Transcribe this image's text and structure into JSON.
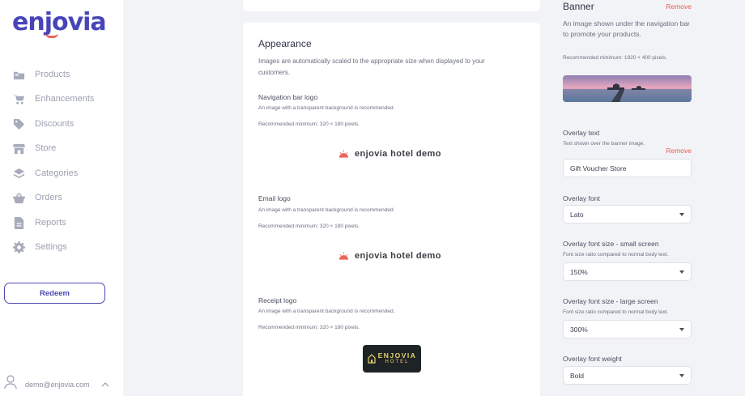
{
  "brand": {
    "name": "enjovia",
    "accent": "#4745b8",
    "dot_color": "#e9665b"
  },
  "sidebar": {
    "items": [
      {
        "label": "Products",
        "icon": "products-icon"
      },
      {
        "label": "Enhancements",
        "icon": "cart-icon"
      },
      {
        "label": "Discounts",
        "icon": "tag-icon"
      },
      {
        "label": "Store",
        "icon": "store-icon"
      },
      {
        "label": "Categories",
        "icon": "layers-icon"
      },
      {
        "label": "Orders",
        "icon": "basket-icon"
      },
      {
        "label": "Reports",
        "icon": "file-icon"
      },
      {
        "label": "Settings",
        "icon": "gear-icon"
      }
    ],
    "redeem_label": "Redeem",
    "user_email": "demo@enjovia.com",
    "user_chevron": "^"
  },
  "appearance": {
    "title": "Appearance",
    "intro": "Images are automatically scaled to the appropriate size when displayed to your customers.",
    "nav_logo": {
      "title": "Navigation bar logo",
      "desc": "An image with a transparent background is recommended.",
      "rec": "Recommended minimum: 320 × 180 pixels.",
      "logo_text": "enjovia hotel demo"
    },
    "email_logo": {
      "title": "Email logo",
      "desc": "An image with a transparent background is recommended.",
      "rec": "Recommended minimum: 320 × 180 pixels.",
      "logo_text": "enjovia hotel demo"
    },
    "receipt_logo": {
      "title": "Receipt logo",
      "desc": "An image with a transparent background is recommended.",
      "rec": "Recommended minimum: 320 × 180 pixels.",
      "logo_text": "ENJOVIA",
      "logo_sub": "HOTEL"
    }
  },
  "banner": {
    "title": "Banner",
    "remove_label": "Remove",
    "desc": "An image shown under the navigation bar to promote your products.",
    "rec": "Recommended minimum: 1920 × 400 pixels.",
    "overlay_text": {
      "label": "Overlay text",
      "help": "Text shown over the banner image.",
      "remove_label": "Remove",
      "value": "Gift Voucher Store"
    },
    "overlay_font": {
      "label": "Overlay font",
      "value": "Lato"
    },
    "font_small": {
      "label": "Overlay font size - small screen",
      "help": "Font size ratio compared to normal body text.",
      "value": "150%"
    },
    "font_large": {
      "label": "Overlay font size - large screen",
      "help": "Font size ratio compared to normal body text.",
      "value": "300%"
    },
    "font_weight": {
      "label": "Overlay font weight",
      "value": "Bold"
    }
  }
}
